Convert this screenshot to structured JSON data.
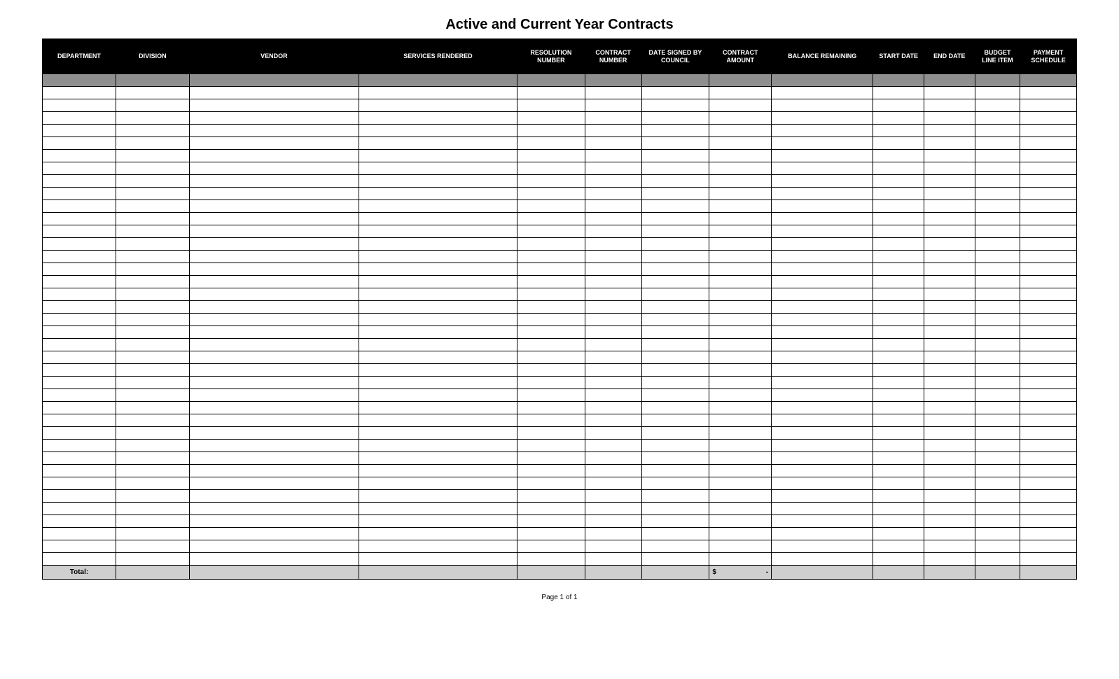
{
  "title": "Active and Current Year Contracts",
  "columns": [
    "DEPARTMENT",
    "DIVISION",
    "VENDOR",
    "SERVICES RENDERED",
    "RESOLUTION NUMBER",
    "CONTRACT NUMBER",
    "DATE SIGNED BY COUNCIL",
    "CONTRACT AMOUNT",
    "BALANCE REMAINING",
    "START DATE",
    "END DATE",
    "BUDGET LINE ITEM",
    "PAYMENT SCHEDULE"
  ],
  "blank_row_count": 38,
  "total": {
    "label": "Total:",
    "currency_symbol": "$",
    "amount_display": "-"
  },
  "footer": "Page 1 of 1"
}
